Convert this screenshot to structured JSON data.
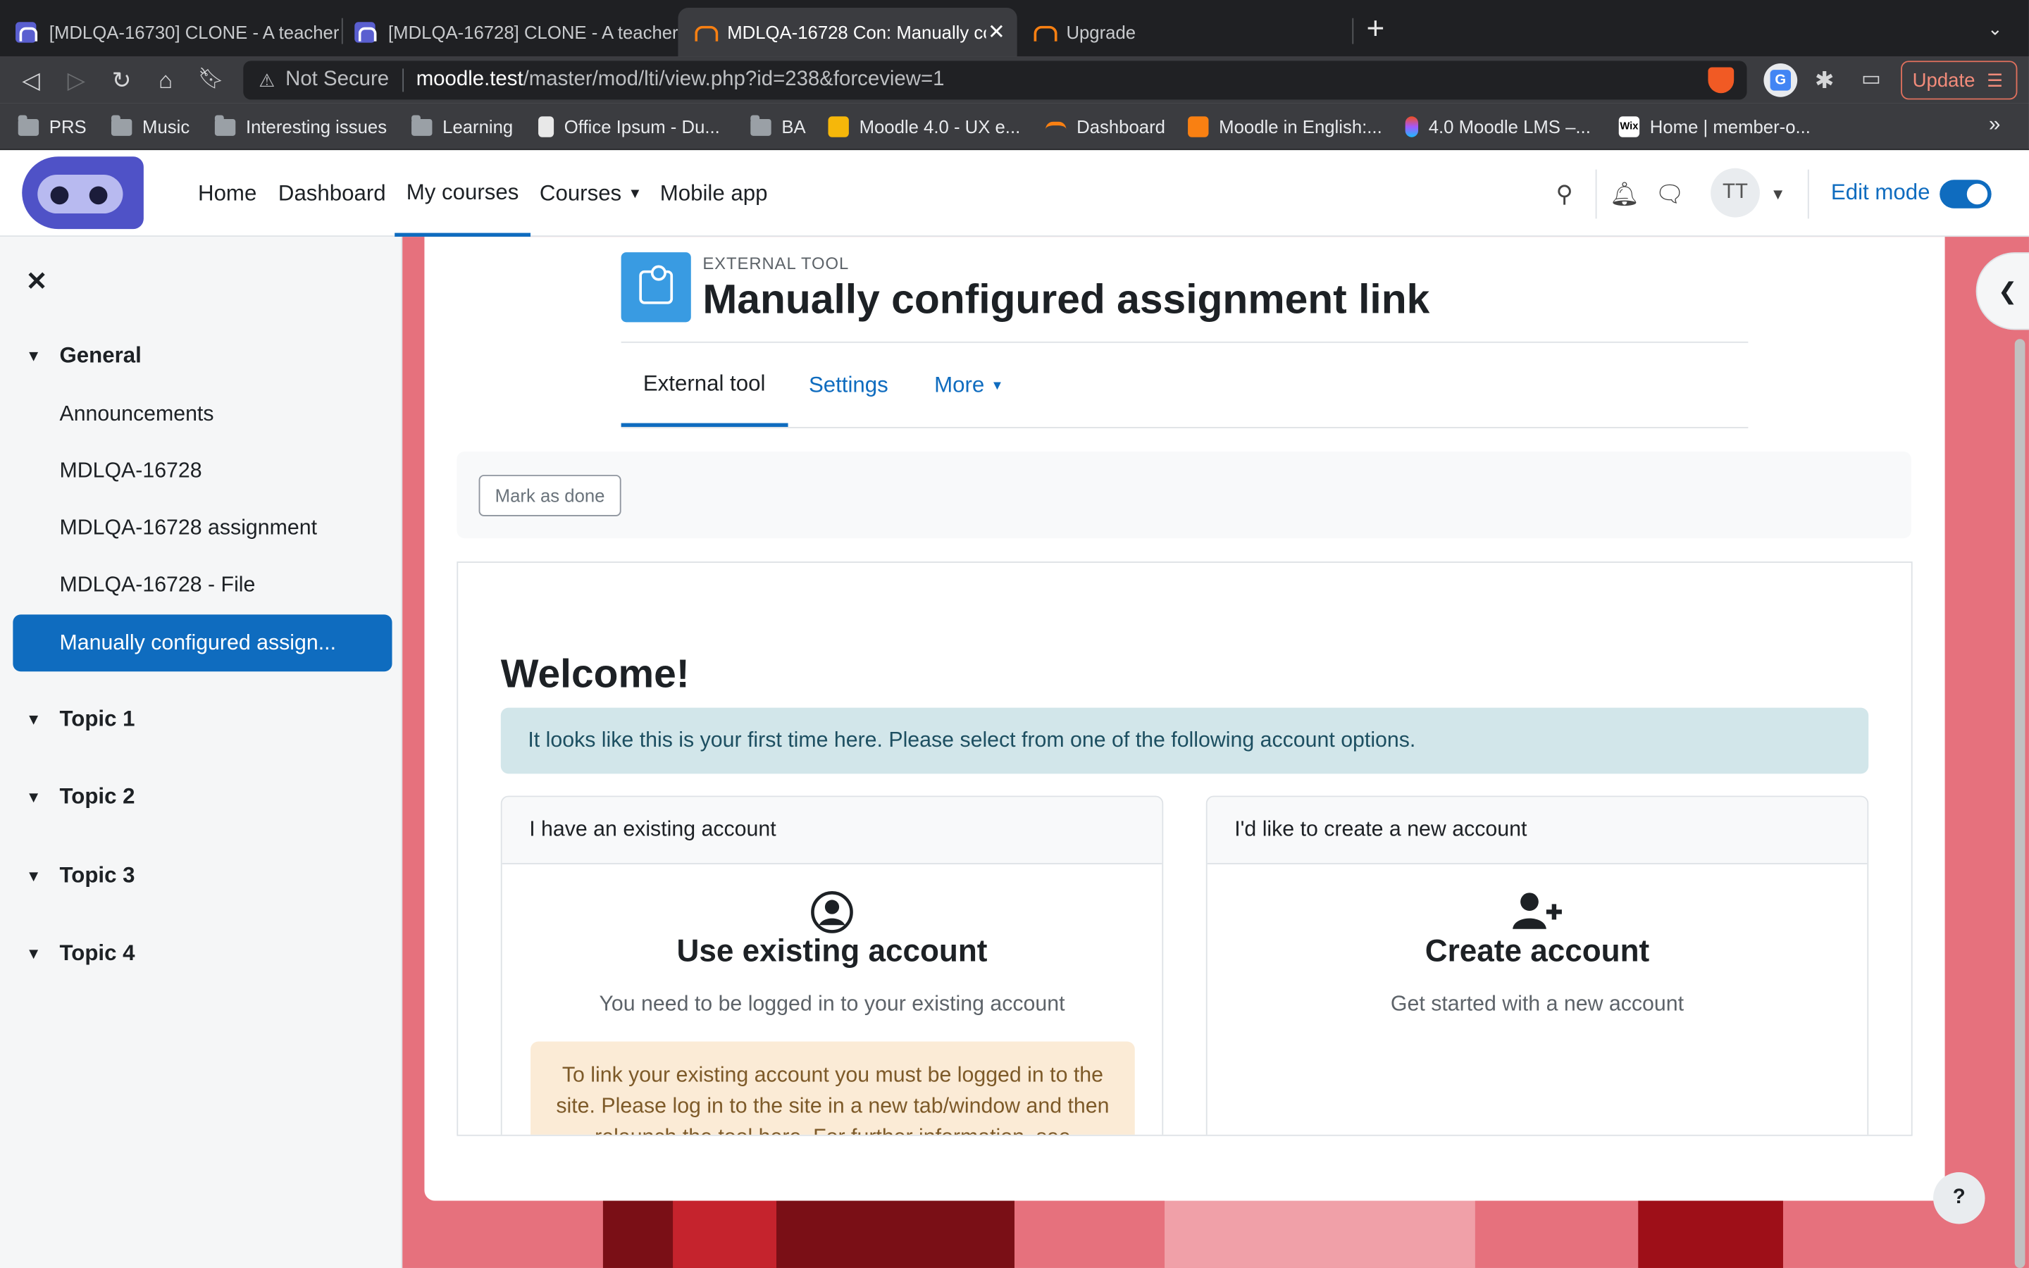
{
  "browser": {
    "tabs": [
      {
        "title": "[MDLQA-16730] CLONE - A teacher"
      },
      {
        "title": "[MDLQA-16728] CLONE - A teacher"
      },
      {
        "title": "MDLQA-16728 Con: Manually co"
      },
      {
        "title": "Upgrade"
      }
    ],
    "url": {
      "security": "Not Secure",
      "host": "moodle.test",
      "path": "/master/mod/lti/view.php?id=238&forceview=1"
    },
    "update_label": "Update",
    "bookmarks": [
      {
        "label": "PRS",
        "icon": "folder-icon"
      },
      {
        "label": "Music",
        "icon": "folder-icon"
      },
      {
        "label": "Interesting issues",
        "icon": "folder-icon"
      },
      {
        "label": "Learning",
        "icon": "folder-icon"
      },
      {
        "label": "Office Ipsum - Du...",
        "icon": "page-icon"
      },
      {
        "label": "BA",
        "icon": "folder-icon"
      },
      {
        "label": "Moodle 4.0 - UX e...",
        "icon": "slides-icon"
      },
      {
        "label": "Dashboard",
        "icon": "moodle-icon"
      },
      {
        "label": "Moodle in English:...",
        "icon": "moodle-icon"
      },
      {
        "label": "4.0 Moodle LMS –...",
        "icon": "figma-icon"
      },
      {
        "label": "Home | member-o...",
        "icon": "wix-icon"
      }
    ]
  },
  "navbar": {
    "links": [
      "Home",
      "Dashboard",
      "My courses",
      "Courses",
      "Mobile app"
    ],
    "avatar": "TT",
    "edit_mode": "Edit mode"
  },
  "drawer": {
    "sections": [
      {
        "title": "General",
        "items": [
          "Announcements",
          "MDLQA-16728",
          "MDLQA-16728 assignment",
          "MDLQA-16728 - File",
          "Manually configured assign..."
        ]
      },
      {
        "title": "Topic 1"
      },
      {
        "title": "Topic 2"
      },
      {
        "title": "Topic 3"
      },
      {
        "title": "Topic 4"
      }
    ]
  },
  "activity": {
    "kind": "EXTERNAL TOOL",
    "title": "Manually configured assignment link",
    "tabs": [
      "External tool",
      "Settings",
      "More"
    ],
    "mark_done": "Mark as done"
  },
  "tool": {
    "welcome": "Welcome!",
    "alert": "It looks like this is your first time here. Please select from one of the following account options.",
    "cards": [
      {
        "header": "I have an existing account",
        "title": "Use existing account",
        "subtitle": "You need to be logged in to your existing account",
        "note": "To link your existing account you must be logged in to the site. Please log in to the site in a new tab/window and then relaunch the tool here. For further information, see"
      },
      {
        "header": "I'd like to create a new account",
        "title": "Create account",
        "subtitle": "Get started with a new account"
      }
    ]
  },
  "colors": {
    "primary": "#0f6cbf",
    "tool_icon": "#399be2",
    "alert_bg": "#d2e6ea",
    "note_bg": "#fbebd6"
  }
}
